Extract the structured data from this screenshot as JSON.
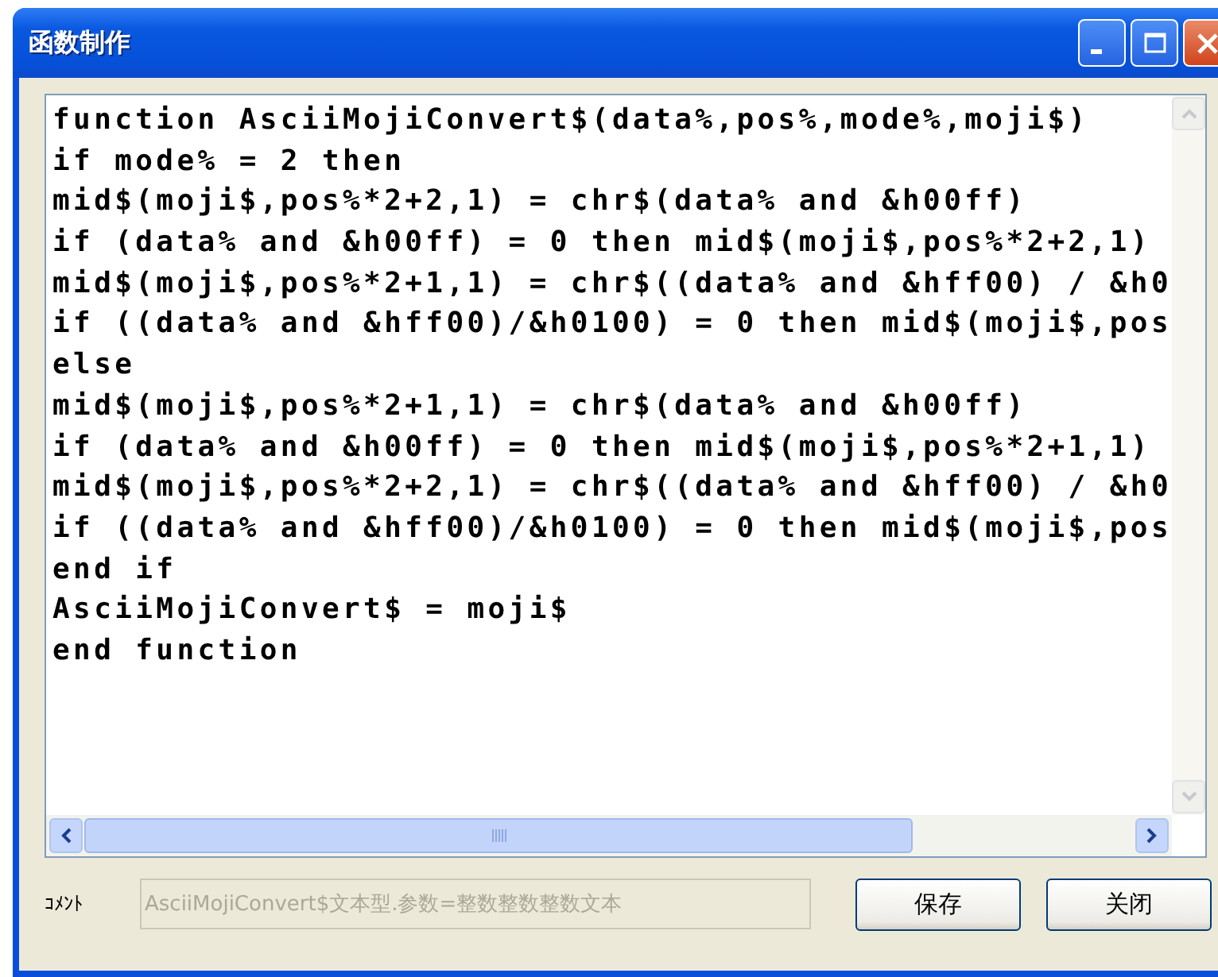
{
  "window": {
    "title": "函数制作"
  },
  "editor": {
    "lines": [
      "function AsciiMojiConvert$(data%,pos%,mode%,moji$)",
      "if mode% = 2 then",
      "mid$(moji$,pos%*2+2,1) = chr$(data% and &h00ff)",
      "if (data% and &h00ff) = 0 then mid$(moji$,pos%*2+2,1)",
      "mid$(moji$,pos%*2+1,1) = chr$((data% and &hff00) / &h0",
      "if ((data% and &hff00)/&h0100) = 0 then mid$(moji$,pos",
      "else",
      "mid$(moji$,pos%*2+1,1) = chr$(data% and &h00ff)",
      "if (data% and &h00ff) = 0 then mid$(moji$,pos%*2+1,1)",
      "mid$(moji$,pos%*2+2,1) = chr$((data% and &hff00) / &h0",
      "if ((data% and &hff00)/&h0100) = 0 then mid$(moji$,pos",
      "end if",
      "AsciiMojiConvert$ = moji$",
      "end function"
    ]
  },
  "comment": {
    "label": "ｺﾒﾝﾄ",
    "value": "AsciiMojiConvert$文本型.参数=整数整数整数文本",
    "disabled": true
  },
  "buttons": [
    "保存",
    "关闭"
  ]
}
